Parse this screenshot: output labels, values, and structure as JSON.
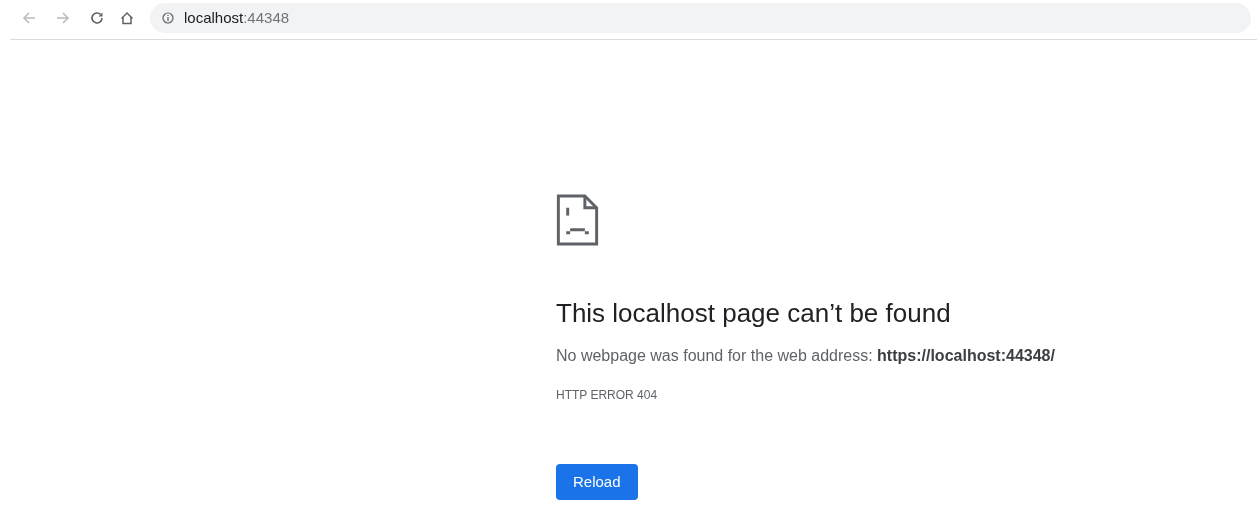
{
  "toolbar": {
    "address": {
      "host": "localhost",
      "port": ":44348"
    }
  },
  "error": {
    "title": "This localhost page can’t be found",
    "message": "No webpage was found for the web address: **https://localhost:44348/**",
    "code": "HTTP ERROR 404",
    "button": "Reload"
  }
}
